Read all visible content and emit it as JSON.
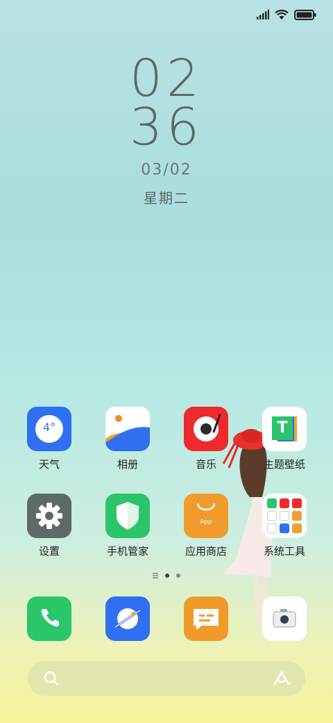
{
  "clock": {
    "hour": "02",
    "minute": "36",
    "date": "03/02",
    "weekday": "星期二"
  },
  "status": {
    "signal_icon": "signal-icon",
    "wifi_icon": "wifi-icon",
    "battery_icon": "battery-icon"
  },
  "apps_row1": [
    {
      "label": "天气",
      "icon": "weather-icon",
      "temp": "4°"
    },
    {
      "label": "相册",
      "icon": "gallery-icon"
    },
    {
      "label": "音乐",
      "icon": "music-icon"
    },
    {
      "label": "主题壁纸",
      "icon": "themes-icon",
      "glyph": "T"
    }
  ],
  "apps_row2": [
    {
      "label": "设置",
      "icon": "settings-icon"
    },
    {
      "label": "手机管家",
      "icon": "security-icon"
    },
    {
      "label": "应用商店",
      "icon": "app-store-icon",
      "sub": "App"
    },
    {
      "label": "系统工具",
      "icon": "system-tools-folder-icon"
    }
  ],
  "dock": [
    {
      "icon": "phone-icon"
    },
    {
      "icon": "browser-icon"
    },
    {
      "icon": "messages-icon"
    },
    {
      "icon": "camera-icon"
    }
  ],
  "colors": {
    "weather": "#2f6ff0",
    "music": "#ee2a2d",
    "settings": "#5e6a68",
    "security": "#2bc46a",
    "store": "#f09b2c",
    "phone": "#2ac76a",
    "browser": "#2f6ff0",
    "messages": "#f19a2a"
  }
}
